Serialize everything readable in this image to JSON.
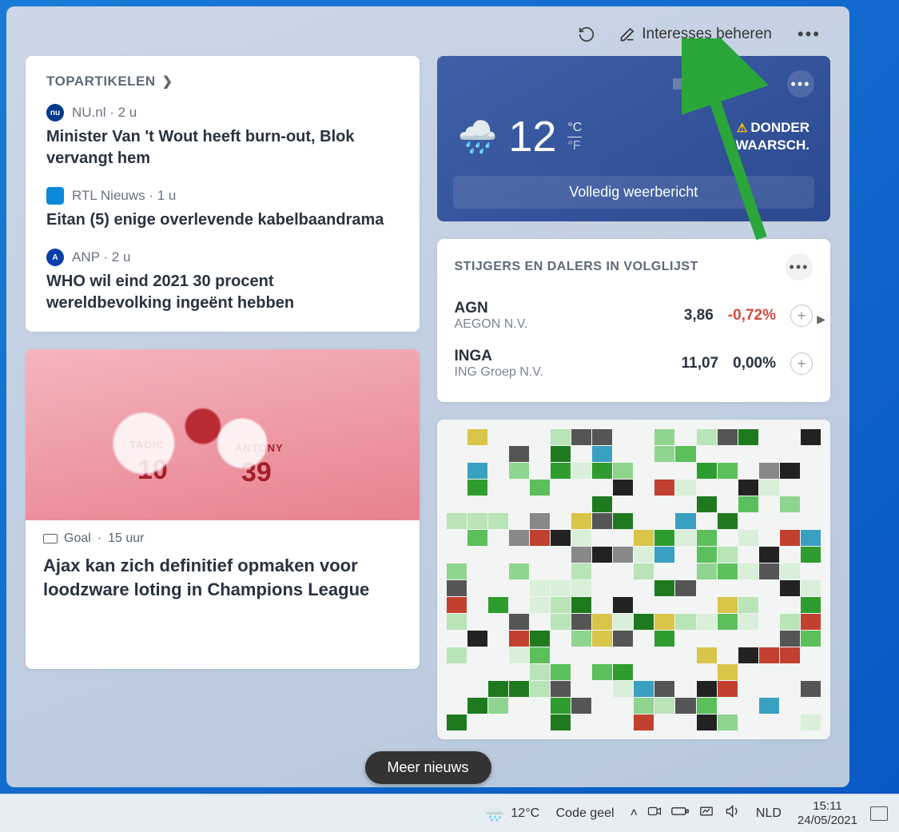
{
  "header": {
    "manage_interests": "Interesses beheren"
  },
  "topArticles": {
    "title": "TOPARTIKELEN",
    "items": [
      {
        "source": "NU.nl",
        "time": "2 u",
        "headline": "Minister Van 't Wout heeft burn-out, Blok vervangt hem"
      },
      {
        "source": "RTL Nieuws",
        "time": "1 u",
        "headline": "Eitan (5) enige overlevende kabelbaandrama"
      },
      {
        "source": "ANP",
        "time": "2 u",
        "headline": "WHO wil eind 2021 30 procent wereldbevolking ingeënt hebben"
      }
    ]
  },
  "weather": {
    "temp": "12",
    "unit_c": "°C",
    "unit_f": "°F",
    "warn_line1": "DONDER",
    "warn_line2": "WAARSCH.",
    "full_link": "Volledig weerbericht"
  },
  "stocks": {
    "title": "STIJGERS EN DALERS IN VOLGLIJST",
    "rows": [
      {
        "sym": "AGN",
        "full": "AEGON N.V.",
        "price": "3,86",
        "change": "-0,72%",
        "cls": "neg"
      },
      {
        "sym": "INGA",
        "full": "ING Groep N.V.",
        "price": "11,07",
        "change": "0,00%",
        "cls": "neu"
      }
    ]
  },
  "bigNews": {
    "source": "Goal",
    "time": "15 uur",
    "headline": "Ajax kan zich definitief opmaken voor loodzware loting in Champions League",
    "jersey1_name": "TADIĆ",
    "jersey1_num": "10",
    "jersey2_name": "ANTONY",
    "jersey2_num": "39"
  },
  "moreNews": "Meer nieuws",
  "taskbar": {
    "temp": "12°C",
    "status": "Code geel",
    "lang": "NLD",
    "time": "15:11",
    "date": "24/05/2021"
  },
  "colors": {
    "accent": "#0366d6",
    "warn": "#ffc107",
    "neg": "#d44a3f"
  }
}
